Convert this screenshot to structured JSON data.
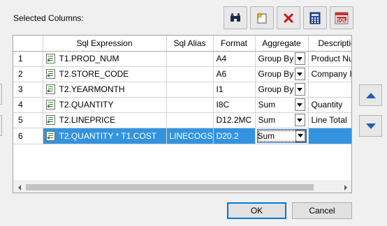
{
  "selected_columns_label": "Selected Columns:",
  "toolbar": [
    {
      "name": "find-icon"
    },
    {
      "name": "new-expression-icon"
    },
    {
      "name": "delete-icon"
    },
    {
      "name": "calculator-icon"
    },
    {
      "name": "sql-icon"
    }
  ],
  "table": {
    "headers": [
      "",
      "Sql Expression",
      "Sql Alias",
      "Format",
      "Aggregate",
      "Description"
    ],
    "rows": [
      {
        "num": "1",
        "expression": "T1.PROD_NUM",
        "alias": "",
        "format": "A4",
        "aggregate": "Group By",
        "description": "Product Number"
      },
      {
        "num": "2",
        "expression": "T2.STORE_CODE",
        "alias": "",
        "format": "A6",
        "aggregate": "Group By",
        "description": "Company ID"
      },
      {
        "num": "3",
        "expression": "T2.YEARMONTH",
        "alias": "",
        "format": "I1",
        "aggregate": "Group By",
        "description": ""
      },
      {
        "num": "4",
        "expression": "T2.QUANTITY",
        "alias": "",
        "format": "I8C",
        "aggregate": "Sum",
        "description": "Quantity"
      },
      {
        "num": "5",
        "expression": "T2.LINEPRICE",
        "alias": "",
        "format": "D12.2MC",
        "aggregate": "Sum",
        "description": "Line Total"
      },
      {
        "num": "6",
        "expression": "T2.QUANTITY * T1.COST",
        "alias": "LINECOGS",
        "format": "D20.2",
        "aggregate": "Sum",
        "description": ""
      }
    ],
    "selected_row": 6
  },
  "buttons": {
    "ok": "OK",
    "cancel": "Cancel"
  },
  "colors": {
    "selection": "#3393df",
    "arrow": "#1f5fae"
  }
}
